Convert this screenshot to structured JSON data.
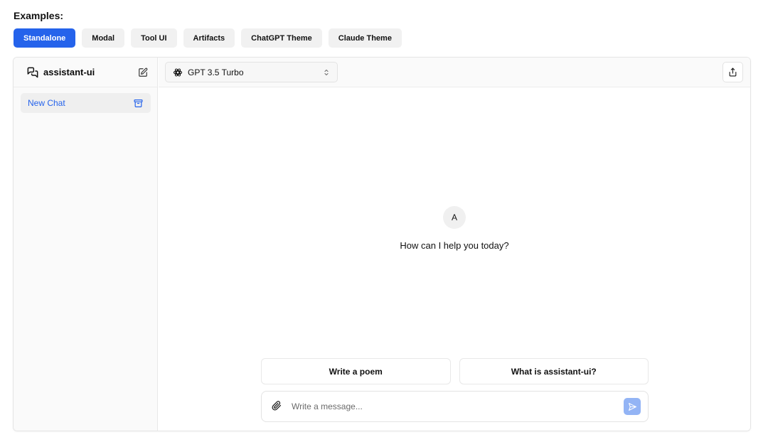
{
  "examples": {
    "title": "Examples:",
    "tabs": [
      {
        "label": "Standalone",
        "active": true
      },
      {
        "label": "Modal",
        "active": false
      },
      {
        "label": "Tool UI",
        "active": false
      },
      {
        "label": "Artifacts",
        "active": false
      },
      {
        "label": "ChatGPT Theme",
        "active": false
      },
      {
        "label": "Claude Theme",
        "active": false
      }
    ]
  },
  "sidebar": {
    "brand": "assistant-ui",
    "brand_icon": "messages-icon",
    "new_thread_icon": "edit-icon",
    "threads": [
      {
        "label": "New Chat",
        "archive_icon": "archive-icon"
      }
    ]
  },
  "header": {
    "model": "GPT 3.5 Turbo",
    "model_icon": "openai-icon",
    "share_icon": "share-icon"
  },
  "welcome": {
    "avatar": "A",
    "message": "How can I help you today?"
  },
  "suggestions": [
    "Write a poem",
    "What is assistant-ui?"
  ],
  "composer": {
    "placeholder": "Write a message...",
    "value": "",
    "attach_icon": "paperclip-icon",
    "send_icon": "send-icon"
  },
  "colors": {
    "accent": "#2563eb",
    "send_button": "#93b4f5"
  }
}
